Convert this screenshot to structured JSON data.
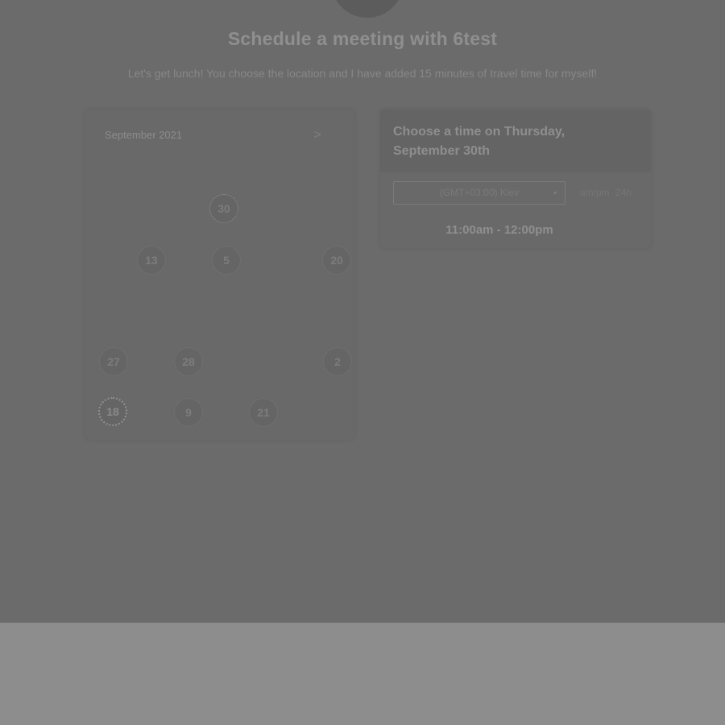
{
  "header": {
    "title": "Schedule a meeting with 6test",
    "description": "Let's get lunch! You choose the location and I have added 15 minutes of travel time for myself!"
  },
  "calendar": {
    "month_label": "September 2021",
    "next_icon": "chevron-right-icon",
    "next_glyph": ">",
    "weekdays": [
      "",
      "",
      "",
      "",
      "",
      "",
      ""
    ],
    "days": [
      {
        "label": "30",
        "state": "selected"
      },
      {
        "label": "13",
        "state": "available"
      },
      {
        "label": "5",
        "state": "available"
      },
      {
        "label": "20",
        "state": "available"
      },
      {
        "label": "27",
        "state": "available"
      },
      {
        "label": "28",
        "state": "available"
      },
      {
        "label": "2",
        "state": "available"
      },
      {
        "label": "18",
        "state": "today"
      },
      {
        "label": "9",
        "state": "available"
      },
      {
        "label": "21",
        "state": "available"
      }
    ]
  },
  "time_panel": {
    "title": "Choose a time on Thursday, September 30th",
    "timezone": "(GMT+03:00) Kiev",
    "caret_glyph": "▾",
    "format_options": [
      "am/pm",
      "24h"
    ],
    "slots": [
      "11:00am - 12:00pm"
    ]
  },
  "colors": {
    "page_background": "#6b6b6b",
    "bottom_background": "#8d8d8d"
  }
}
